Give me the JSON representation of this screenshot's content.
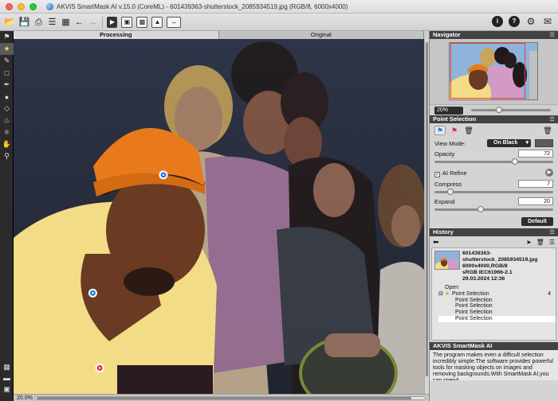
{
  "window": {
    "title": "AKVIS SmartMask AI v.15.0 (CoreML) - 601439363-shutterstock_2085934519.jpg (RGB/8, 6000x4000)"
  },
  "tabs": [
    {
      "label": "Processing",
      "active": true
    },
    {
      "label": "Original",
      "active": false
    }
  ],
  "toolbar": {
    "icons": [
      "open-file-icon",
      "save-file-icon",
      "print-icon",
      "batch-icon",
      "settings-grid-icon",
      "undo-icon",
      "redo-icon",
      "run-icon",
      "mask-icon",
      "layer-icon",
      "image-icon",
      "compare-icon"
    ],
    "right_icons": [
      "info-icon",
      "help-icon",
      "settings-icon",
      "notifications-icon"
    ]
  },
  "tools": [
    "point-selection-icon",
    "star-selection-icon",
    "color-picker-icon",
    "rectangle-icon",
    "magic-brush-icon",
    "drop-icon",
    "eraser-icon",
    "bucket-icon",
    "history-brush-icon",
    "hand-icon",
    "zoom-icon"
  ],
  "statusbar": {
    "zoom": "20.0%"
  },
  "navigator": {
    "title": "Navigator",
    "zoom": "20%",
    "zoom_slider": 0.35
  },
  "point_selection": {
    "title": "Point Selection",
    "view_mode_label": "View Mode:",
    "view_mode": "On Black",
    "opacity_label": "Opacity",
    "opacity": "72",
    "ai_refine_label": "AI Refine",
    "ai_refine_checked": true,
    "compress_label": "Compress",
    "compress": "7",
    "expand_label": "Expand",
    "expand": "20",
    "default_label": "Default"
  },
  "history": {
    "title": "History",
    "file_lines": [
      "601439363-",
      "shutterstock_2085934519.jpg",
      "6000x4000,RGB/8",
      "sRGB IEC61966-2.1",
      "29.03.2024 12:36"
    ],
    "open_label": "Open",
    "group_label": "Point Selection",
    "group_count": "4",
    "steps": [
      "Point Selection",
      "Point Selection",
      "Point Selection",
      "Point Selection"
    ]
  },
  "about": {
    "title": "AKVIS SmartMask AI",
    "text": "The program makes even a difficult selection incredibly simple.The software provides powerful tools for masking objects on images and removing backgrounds.With SmartMask AI,you can spend"
  },
  "points": [
    {
      "type": "blue",
      "x": 0.365,
      "y": 0.383
    },
    {
      "type": "blue",
      "x": 0.193,
      "y": 0.716
    },
    {
      "type": "red",
      "x": 0.21,
      "y": 0.927
    }
  ],
  "colors": {
    "accent_blue": "#1d7de2",
    "accent_red": "#e0263a",
    "hat_orange": "#e87a1c",
    "shirt_yellow": "#f3dc86"
  }
}
